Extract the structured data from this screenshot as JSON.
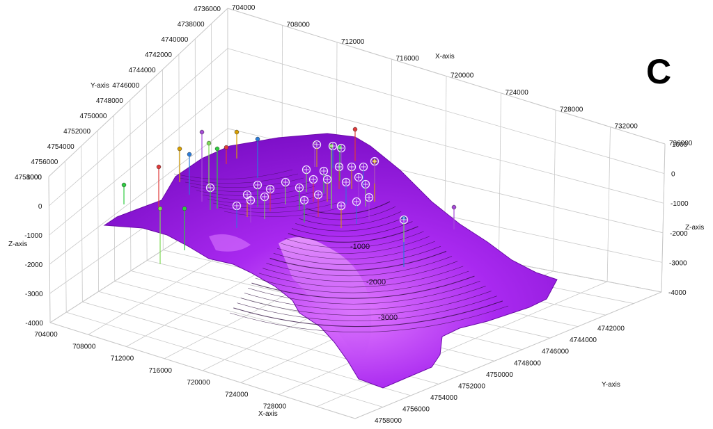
{
  "chart_data": {
    "type": "surface3d",
    "panel_label": "C",
    "axes": {
      "x": {
        "label": "X-axis",
        "range": [
          704000,
          736000
        ],
        "ticks": [
          704000,
          708000,
          712000,
          716000,
          720000,
          724000,
          728000,
          732000,
          736000
        ]
      },
      "y": {
        "label": "Y-axis",
        "range": [
          4736000,
          4758000
        ],
        "ticks": [
          4736000,
          4738000,
          4740000,
          4742000,
          4744000,
          4746000,
          4748000,
          4750000,
          4752000,
          4754000,
          4756000,
          4758000
        ]
      },
      "z": {
        "label": "Z-axis",
        "range": [
          -4000,
          1000
        ],
        "ticks": [
          -4000,
          -3000,
          -2000,
          -1000,
          0,
          1000
        ]
      }
    },
    "grid": true,
    "surface_color": "#9b1fe8",
    "contour_labels": [
      "-1000",
      "-2000",
      "-3000"
    ]
  }
}
